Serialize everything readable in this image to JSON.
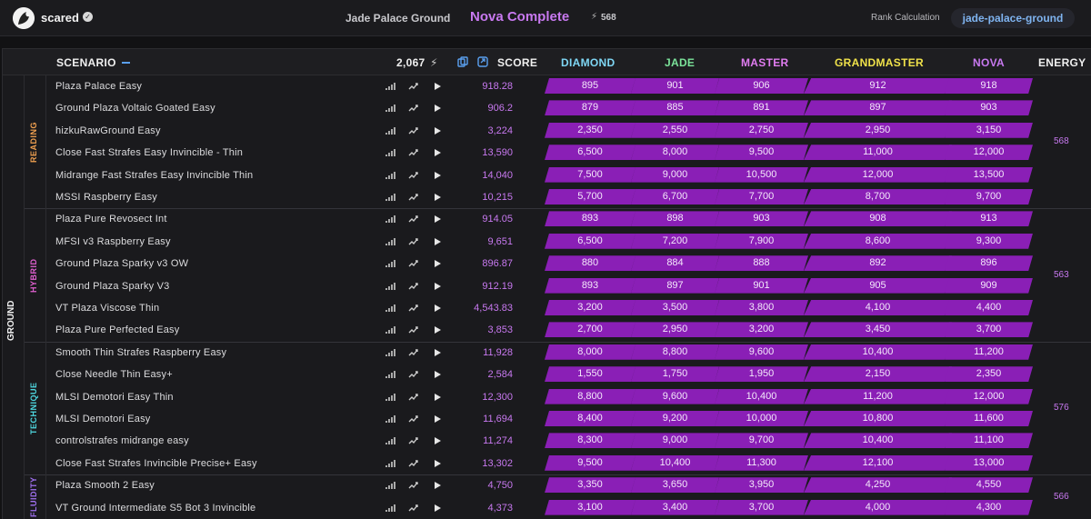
{
  "header": {
    "username": "scared",
    "location": "Jade Palace Ground",
    "rank_status": "Nova Complete",
    "energy_total": "568",
    "rank_calc_label": "Rank Calculation",
    "rank_calc_value": "jade-palace-ground"
  },
  "columns": {
    "scenario": "SCENARIO",
    "total": "2,067",
    "score": "SCORE",
    "diamond": "DIAMOND",
    "jade": "JADE",
    "master": "MASTER",
    "grandmaster": "GRANDMASTER",
    "nova": "NOVA",
    "energy": "ENERGY"
  },
  "colors": {
    "diamond": "#7fd7f5",
    "jade": "#7be39a",
    "master": "#e07cf0",
    "grandmaster": "#f0e24a",
    "nova": "#c879f0",
    "bar": "#8a1fb6"
  },
  "group": "GROUND",
  "sections": [
    {
      "name": "READING",
      "color": "#f0a050",
      "energy": "568",
      "rows": [
        {
          "name": "Plaza Palace Easy",
          "score": "918.28",
          "ranks": [
            "895",
            "901",
            "906",
            "912",
            "918"
          ]
        },
        {
          "name": "Ground Plaza Voltaic Goated Easy",
          "score": "906.2",
          "ranks": [
            "879",
            "885",
            "891",
            "897",
            "903"
          ]
        },
        {
          "name": "hizkuRawGround Easy",
          "score": "3,224",
          "ranks": [
            "2,350",
            "2,550",
            "2,750",
            "2,950",
            "3,150"
          ]
        },
        {
          "name": "Close Fast Strafes Easy Invincible - Thin",
          "score": "13,590",
          "ranks": [
            "6,500",
            "8,000",
            "9,500",
            "11,000",
            "12,000"
          ]
        },
        {
          "name": "Midrange Fast Strafes Easy Invincible Thin",
          "score": "14,040",
          "ranks": [
            "7,500",
            "9,000",
            "10,500",
            "12,000",
            "13,500"
          ]
        },
        {
          "name": "MSSI Raspberry Easy",
          "score": "10,215",
          "ranks": [
            "5,700",
            "6,700",
            "7,700",
            "8,700",
            "9,700"
          ]
        }
      ]
    },
    {
      "name": "HYBRID",
      "color": "#e060d0",
      "energy": "563",
      "rows": [
        {
          "name": "Plaza Pure Revosect Int",
          "score": "914.05",
          "ranks": [
            "893",
            "898",
            "903",
            "908",
            "913"
          ]
        },
        {
          "name": "MFSI v3 Raspberry Easy",
          "score": "9,651",
          "ranks": [
            "6,500",
            "7,200",
            "7,900",
            "8,600",
            "9,300"
          ]
        },
        {
          "name": "Ground Plaza Sparky v3 OW",
          "score": "896.87",
          "ranks": [
            "880",
            "884",
            "888",
            "892",
            "896"
          ]
        },
        {
          "name": "Ground Plaza Sparky V3",
          "score": "912.19",
          "ranks": [
            "893",
            "897",
            "901",
            "905",
            "909"
          ]
        },
        {
          "name": "VT Plaza Viscose Thin",
          "score": "4,543.83",
          "ranks": [
            "3,200",
            "3,500",
            "3,800",
            "4,100",
            "4,400"
          ]
        },
        {
          "name": "Plaza Pure Perfected Easy",
          "score": "3,853",
          "ranks": [
            "2,700",
            "2,950",
            "3,200",
            "3,450",
            "3,700"
          ]
        }
      ]
    },
    {
      "name": "TECHNIQUE",
      "color": "#4ed7e0",
      "energy": "576",
      "rows": [
        {
          "name": "Smooth Thin Strafes Raspberry Easy",
          "score": "11,928",
          "ranks": [
            "8,000",
            "8,800",
            "9,600",
            "10,400",
            "11,200"
          ]
        },
        {
          "name": "Close Needle Thin Easy+",
          "score": "2,584",
          "ranks": [
            "1,550",
            "1,750",
            "1,950",
            "2,150",
            "2,350"
          ]
        },
        {
          "name": "MLSI Demotori Easy Thin",
          "score": "12,300",
          "ranks": [
            "8,800",
            "9,600",
            "10,400",
            "11,200",
            "12,000"
          ]
        },
        {
          "name": "MLSI Demotori Easy",
          "score": "11,694",
          "ranks": [
            "8,400",
            "9,200",
            "10,000",
            "10,800",
            "11,600"
          ]
        },
        {
          "name": "controlstrafes midrange easy",
          "score": "11,274",
          "ranks": [
            "8,300",
            "9,000",
            "9,700",
            "10,400",
            "11,100"
          ]
        },
        {
          "name": "Close Fast Strafes Invincible Precise+ Easy",
          "score": "13,302",
          "ranks": [
            "9,500",
            "10,400",
            "11,300",
            "12,100",
            "13,000"
          ]
        }
      ]
    },
    {
      "name": "FLUIDITY",
      "color": "#a070f0",
      "energy": "566",
      "rows": [
        {
          "name": "Plaza Smooth 2 Easy",
          "score": "4,750",
          "ranks": [
            "3,350",
            "3,650",
            "3,950",
            "4,250",
            "4,550"
          ]
        },
        {
          "name": "VT Ground Intermediate S5 Bot 3 Invincible",
          "score": "4,373",
          "ranks": [
            "3,100",
            "3,400",
            "3,700",
            "4,000",
            "4,300"
          ]
        }
      ]
    }
  ]
}
